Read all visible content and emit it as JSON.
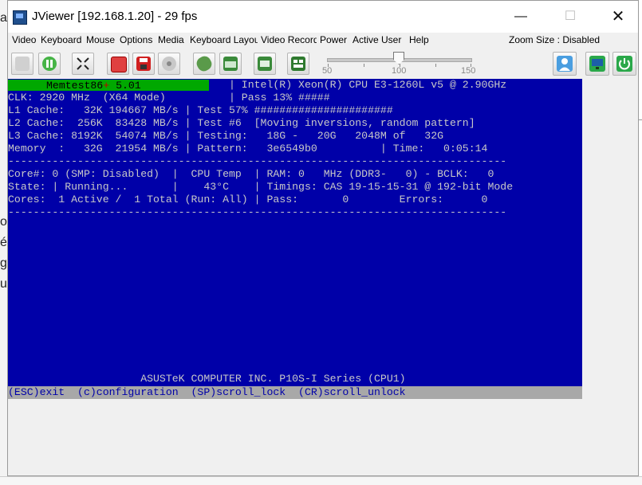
{
  "window": {
    "title": "JViewer [192.168.1.20] - 29 fps",
    "min_glyph": "—",
    "max_glyph": "☐",
    "close_glyph": "✕"
  },
  "background": {
    "left_fragments": [
      "ar",
      "or",
      "é",
      "g",
      "u"
    ]
  },
  "menubar": {
    "items": [
      "Video",
      "Keyboard",
      "Mouse",
      "Options",
      "Media",
      "Keyboard Layout",
      "Video Record",
      "Power",
      "Active User",
      "Help"
    ],
    "zoom_label": "Zoom Size : Disabled"
  },
  "toolbar": {
    "buttons": [
      "play-icon",
      "pause-icon",
      "fullscreen-icon",
      "stop-record-icon",
      "save-icon",
      "media-disc-icon",
      "mouse-icon",
      "keyboard-icon",
      "video-icon",
      "network-icon",
      "user-icon",
      "display-icon",
      "power-icon"
    ],
    "slider": {
      "min_label": "50",
      "mid_label": "100",
      "max_label": "150",
      "value": 100
    }
  },
  "console": {
    "header_title": "Memtest86",
    "header_plus": "+",
    "header_version": " 5.01",
    "lines": [
      "                                   | Intel(R) Xeon(R) CPU E3-1260L v5 @ 2.90GHz",
      "CLK: 2920 MHz  (X64 Mode)          | Pass 13% #####",
      "L1 Cache:   32K 194667 MB/s | Test 57% ######################",
      "L2 Cache:  256K  83428 MB/s | Test #6  [Moving inversions, random pattern]",
      "L3 Cache: 8192K  54074 MB/s | Testing:   18G -   20G   2048M of   32G",
      "Memory  :   32G  21954 MB/s | Pattern:   3e6549b0          | Time:   0:05:14",
      "-------------------------------------------------------------------------------",
      "Core#: 0 (SMP: Disabled)  |  CPU Temp  | RAM: 0   MHz (DDR3-   0) - BCLK:   0",
      "State: | Running...       |    43°C    | Timings: CAS 19-15-15-31 @ 192-bit Mode",
      "Cores:  1 Active /  1 Total (Run: All) | Pass:       0        Errors:      0",
      "-------------------------------------------------------------------------------"
    ],
    "bottom_line": "                     ASUSTeK COMPUTER INC. P10S-I Series (CPU1)",
    "footer": "(ESC)exit  (c)configuration  (SP)scroll_lock  (CR)scroll_unlock"
  }
}
